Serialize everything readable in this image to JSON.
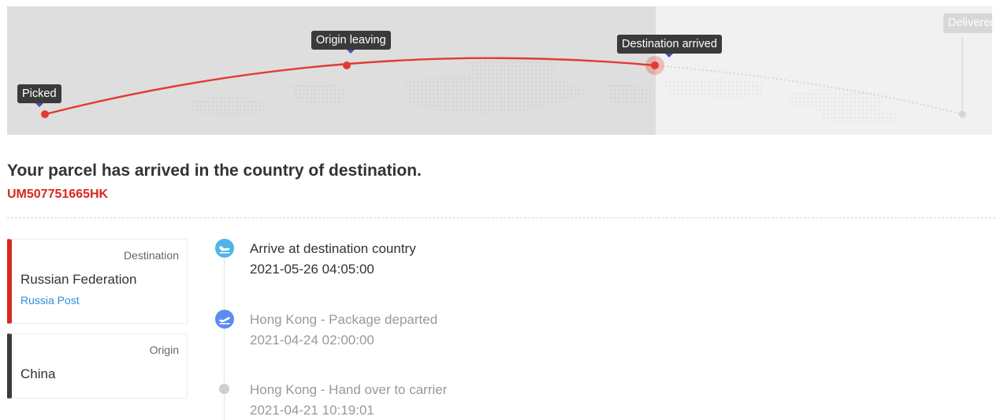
{
  "route": {
    "stops": [
      {
        "label": "Picked",
        "state": "done"
      },
      {
        "label": "Origin leaving",
        "state": "done"
      },
      {
        "label": "Destination arrived",
        "state": "current"
      },
      {
        "label": "Delivered",
        "state": "pending"
      }
    ],
    "colors": {
      "done": "#e23b33",
      "pending": "#d5d5d5",
      "map_bg": "#dedede",
      "pending_bg": "#f1f1f1"
    }
  },
  "status": {
    "title": "Your parcel has arrived in the country of destination.",
    "tracking_number": "UM507751665HK"
  },
  "destination": {
    "kind": "Destination",
    "country": "Russian Federation",
    "carrier": "Russia Post"
  },
  "origin": {
    "kind": "Origin",
    "country": "China"
  },
  "events": [
    {
      "description": "Arrive at destination country",
      "time": "2021-05-26 04:05:00",
      "icon": "plane-landing-icon",
      "icon_color": "#4fb3e8"
    },
    {
      "description": "Hong Kong - Package departed",
      "time": "2021-04-24 02:00:00",
      "icon": "plane-takeoff-icon",
      "icon_color": "#5b8cf0"
    },
    {
      "description": "Hong Kong - Hand over to carrier",
      "time": "2021-04-21 10:19:01",
      "icon": "dot-icon",
      "icon_color": "#cfcfcf"
    }
  ]
}
